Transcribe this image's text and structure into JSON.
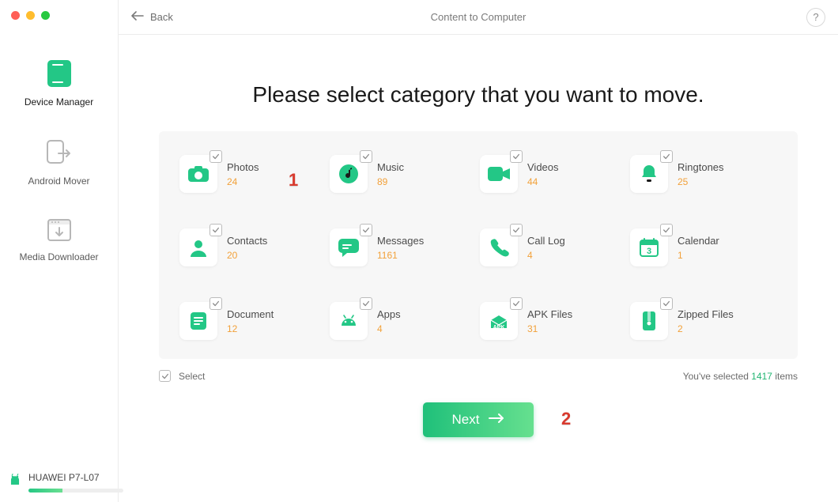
{
  "header": {
    "back_label": "Back",
    "title": "Content to Computer",
    "help_label": "?"
  },
  "sidebar": {
    "items": [
      {
        "label": "Device Manager",
        "active": true
      },
      {
        "label": "Android Mover",
        "active": false
      },
      {
        "label": "Media Downloader",
        "active": false
      }
    ]
  },
  "device": {
    "name": "HUAWEI P7-L07",
    "storage_percent": 36
  },
  "main": {
    "headline": "Please select category that you want to move."
  },
  "categories": [
    {
      "name": "Photos",
      "count": "24",
      "checked": true,
      "icon": "camera"
    },
    {
      "name": "Music",
      "count": "89",
      "checked": true,
      "icon": "music-note"
    },
    {
      "name": "Videos",
      "count": "44",
      "checked": true,
      "icon": "video"
    },
    {
      "name": "Ringtones",
      "count": "25",
      "checked": true,
      "icon": "bell"
    },
    {
      "name": "Contacts",
      "count": "20",
      "checked": true,
      "icon": "contact"
    },
    {
      "name": "Messages",
      "count": "1161",
      "checked": true,
      "icon": "message"
    },
    {
      "name": "Call Log",
      "count": "4",
      "checked": true,
      "icon": "phone"
    },
    {
      "name": "Calendar",
      "count": "1",
      "checked": true,
      "icon": "calendar"
    },
    {
      "name": "Document",
      "count": "12",
      "checked": true,
      "icon": "document"
    },
    {
      "name": "Apps",
      "count": "4",
      "checked": true,
      "icon": "android"
    },
    {
      "name": "APK Files",
      "count": "31",
      "checked": true,
      "icon": "apk"
    },
    {
      "name": "Zipped Files",
      "count": "2",
      "checked": true,
      "icon": "zip"
    }
  ],
  "footer": {
    "select_label": "Select",
    "selected_text_prefix": "You've selected ",
    "selected_count": "1417",
    "selected_text_suffix": " items"
  },
  "next_label": "Next",
  "annotations": {
    "a1": "1",
    "a2": "2"
  },
  "colors": {
    "accent": "#22b573",
    "count": "#f2a13a",
    "annotation": "#d83a2e"
  }
}
